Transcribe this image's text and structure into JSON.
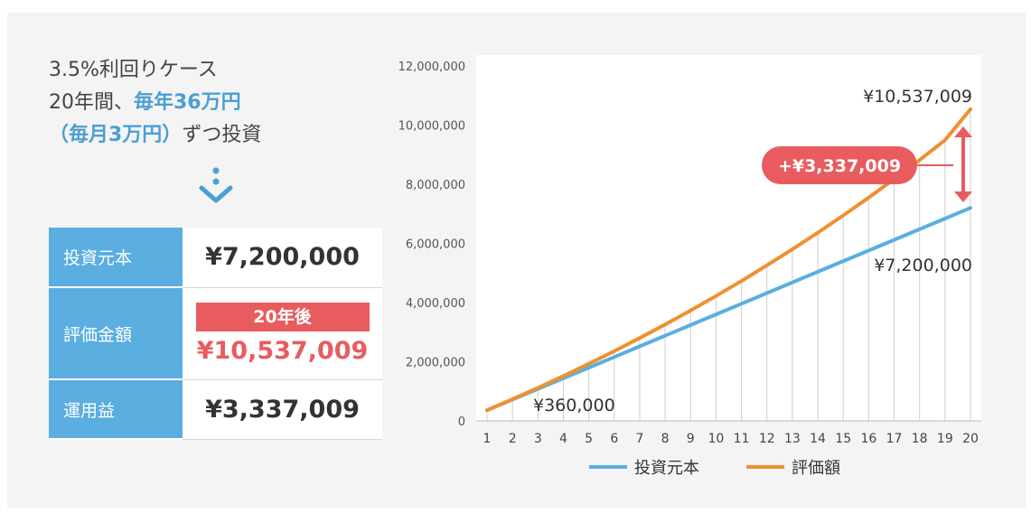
{
  "intro": {
    "line1": "3.5%利回りケース",
    "line2_plain": "20年間、",
    "line2_highlight": "毎年36万円",
    "line3_highlight": "（毎月3万円）",
    "line3_plain": "ずつ投資"
  },
  "summary": {
    "principal_label": "投資元本",
    "principal_value": "¥7,200,000",
    "eval_label": "評価金額",
    "eval_badge": "20年後",
    "eval_value": "¥10,537,009",
    "profit_label": "運用益",
    "profit_value": "¥3,337,009"
  },
  "colors": {
    "principal": "#5aaee0",
    "valuation": "#ee9130",
    "accent": "#e85c60",
    "highlight": "#4a9fd3"
  },
  "chart_data": {
    "type": "line",
    "x": [
      1,
      2,
      3,
      4,
      5,
      6,
      7,
      8,
      9,
      10,
      11,
      12,
      13,
      14,
      15,
      16,
      17,
      18,
      19,
      20
    ],
    "y_ticks": [
      "0",
      "2,000,000",
      "4,000,000",
      "6,000,000",
      "8,000,000",
      "10,000,000",
      "12,000,000"
    ],
    "ylim": [
      0,
      12000000
    ],
    "series": [
      {
        "name": "投資元本",
        "values": [
          360000,
          720000,
          1080000,
          1440000,
          1800000,
          2160000,
          2520000,
          2880000,
          3240000,
          3600000,
          3960000,
          4320000,
          4680000,
          5040000,
          5400000,
          5760000,
          6120000,
          6480000,
          6840000,
          7200000
        ]
      },
      {
        "name": "評価額",
        "values": [
          360000,
          732600,
          1118241,
          1517379,
          1930487,
          2358054,
          2800586,
          3258606,
          3732657,
          4223300,
          4731116,
          5256705,
          5800689,
          6363713,
          6946443,
          7549569,
          8173804,
          8819887,
          9488583,
          10537009
        ]
      }
    ],
    "annotations": {
      "start_label": "¥360,000",
      "end_principal_label": "¥7,200,000",
      "end_valuation_label": "¥10,537,009",
      "difference_label": "+¥3,337,009"
    },
    "grid": "vertical",
    "legend_position": "bottom"
  }
}
